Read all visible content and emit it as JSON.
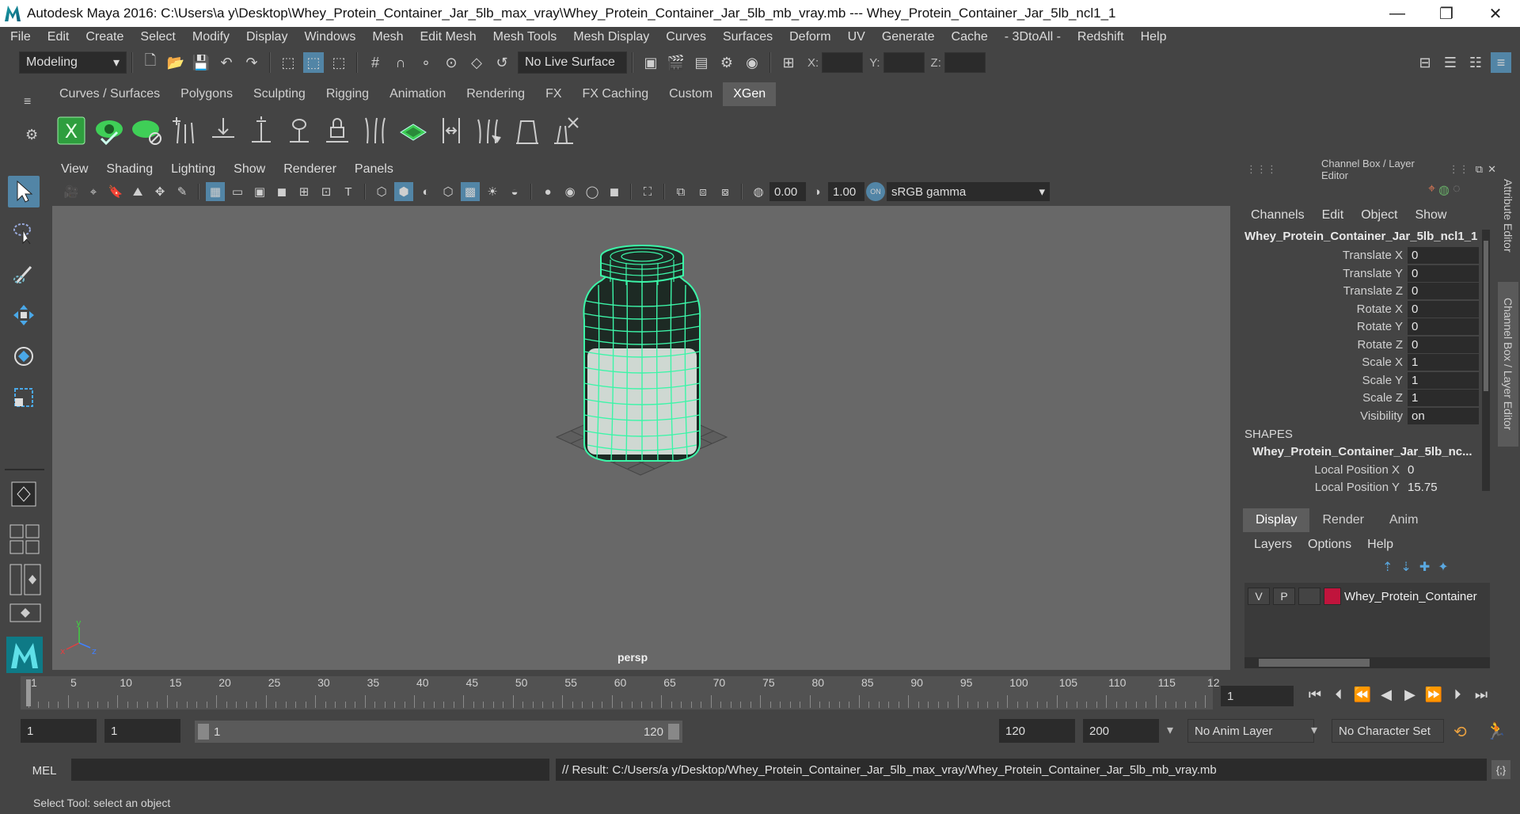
{
  "window": {
    "title": "Autodesk Maya 2016: C:\\Users\\a y\\Desktop\\Whey_Protein_Container_Jar_5lb_max_vray\\Whey_Protein_Container_Jar_5lb_mb_vray.mb   ---   Whey_Protein_Container_Jar_5lb_ncl1_1",
    "minimize": "—",
    "maximize": "❐",
    "close": "✕"
  },
  "menubar": [
    "File",
    "Edit",
    "Create",
    "Select",
    "Modify",
    "Display",
    "Windows",
    "Mesh",
    "Edit Mesh",
    "Mesh Tools",
    "Mesh Display",
    "Curves",
    "Surfaces",
    "Deform",
    "UV",
    "Generate",
    "Cache",
    "- 3DtoAll -",
    "Redshift",
    "Help"
  ],
  "statusline": {
    "mode": "Modeling",
    "live_surface": "No Live Surface",
    "x_label": "X:",
    "y_label": "Y:",
    "z_label": "Z:"
  },
  "shelf": {
    "tabs": [
      "Curves / Surfaces",
      "Polygons",
      "Sculpting",
      "Rigging",
      "Animation",
      "Rendering",
      "FX",
      "FX Caching",
      "Custom",
      "XGen"
    ],
    "active_tab": "XGen"
  },
  "viewport": {
    "menu": [
      "View",
      "Shading",
      "Lighting",
      "Show",
      "Renderer",
      "Panels"
    ],
    "exposure": "0.00",
    "gamma": "1.00",
    "color_space": "sRGB gamma",
    "camera": "persp",
    "axis_x": "x",
    "axis_y": "y",
    "axis_z": "z"
  },
  "channel_box": {
    "header": "Channel Box / Layer Editor",
    "menu": [
      "Channels",
      "Edit",
      "Object",
      "Show"
    ],
    "object": "Whey_Protein_Container_Jar_5lb_ncl1_1",
    "attributes": [
      {
        "name": "Translate X",
        "value": "0"
      },
      {
        "name": "Translate Y",
        "value": "0"
      },
      {
        "name": "Translate Z",
        "value": "0"
      },
      {
        "name": "Rotate X",
        "value": "0"
      },
      {
        "name": "Rotate Y",
        "value": "0"
      },
      {
        "name": "Rotate Z",
        "value": "0"
      },
      {
        "name": "Scale X",
        "value": "1"
      },
      {
        "name": "Scale Y",
        "value": "1"
      },
      {
        "name": "Scale Z",
        "value": "1"
      },
      {
        "name": "Visibility",
        "value": "on"
      }
    ],
    "shapes_label": "SHAPES",
    "shape_object": "Whey_Protein_Container_Jar_5lb_nc...",
    "local_position": [
      {
        "name": "Local Position X",
        "value": "0"
      },
      {
        "name": "Local Position Y",
        "value": "15.75"
      }
    ]
  },
  "side_tabs": {
    "attribute_editor": "Attribute Editor",
    "channel_box": "Channel Box / Layer Editor"
  },
  "layer_editor": {
    "tabs": [
      "Display",
      "Render",
      "Anim"
    ],
    "active_tab": "Display",
    "menu": [
      "Layers",
      "Options",
      "Help"
    ],
    "layer": {
      "v": "V",
      "p": "P",
      "name": "Whey_Protein_Container",
      "color": "#c0143c"
    }
  },
  "timeline": {
    "labels": [
      "1",
      "5",
      "10",
      "15",
      "20",
      "25",
      "30",
      "35",
      "40",
      "45",
      "50",
      "55",
      "60",
      "65",
      "70",
      "75",
      "80",
      "85",
      "90",
      "95",
      "100",
      "105",
      "110",
      "115",
      "12"
    ],
    "current_frame": "1"
  },
  "range": {
    "start": "1",
    "playback_start": "1",
    "slider_start": "1",
    "slider_end": "120",
    "playback_end": "120",
    "end": "200",
    "anim_layer": "No Anim Layer",
    "character_set": "No Character Set"
  },
  "command": {
    "language": "MEL",
    "input": "",
    "result": "// Result: C:/Users/a y/Desktop/Whey_Protein_Container_Jar_5lb_max_vray/Whey_Protein_Container_Jar_5lb_mb_vray.mb"
  },
  "help_line": "Select Tool: select an object",
  "colors": {
    "wireframe": "#3cf5a8",
    "viewport_bg": "#686868",
    "accent": "#5285a6"
  }
}
